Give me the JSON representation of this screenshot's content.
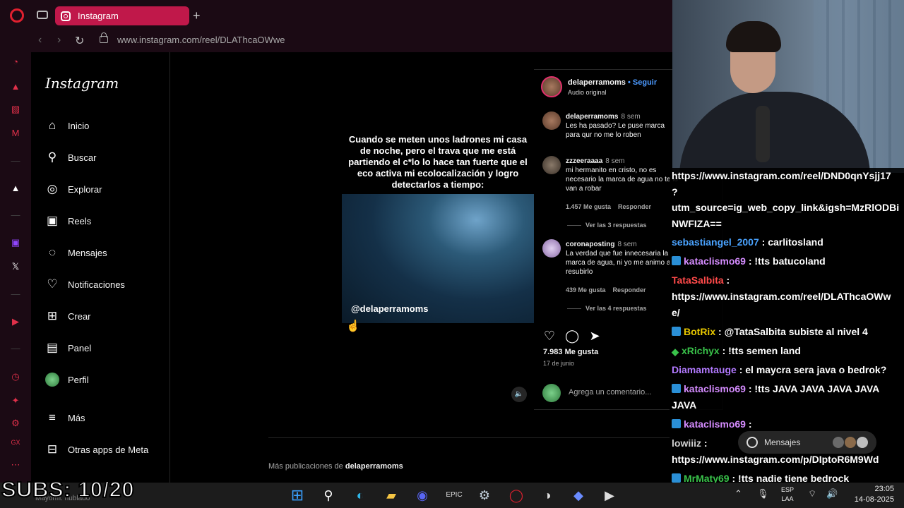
{
  "browser": {
    "tab_title": "Instagram",
    "url": "www.instagram.com/reel/DLAThcaOWwe"
  },
  "instagram": {
    "logo": "Instagram",
    "nav": [
      {
        "label": "Inicio",
        "icon": "home-icon"
      },
      {
        "label": "Buscar",
        "icon": "search-icon"
      },
      {
        "label": "Explorar",
        "icon": "compass-icon"
      },
      {
        "label": "Reels",
        "icon": "reels-icon"
      },
      {
        "label": "Mensajes",
        "icon": "messenger-icon"
      },
      {
        "label": "Notificaciones",
        "icon": "heart-icon"
      },
      {
        "label": "Crear",
        "icon": "plus-square-icon"
      },
      {
        "label": "Panel",
        "icon": "chart-icon"
      },
      {
        "label": "Perfil",
        "icon": "avatar"
      },
      {
        "label": "Más",
        "icon": "menu-icon"
      },
      {
        "label": "Otras apps de Meta",
        "icon": "apps-icon"
      }
    ],
    "post": {
      "caption": "Cuando se meten unos ladrones mi casa de noche, pero el trava que me está partiendo el c*lo lo hace tan fuerte que el eco activa mi ecolocalización y logro detectarlos a tiempo:",
      "watermark": "@delaperramoms",
      "username": "delaperramoms",
      "follow": "• Seguir",
      "audio": "Audio original",
      "likes": "7.983 Me gusta",
      "date": "17 de junio",
      "comment_placeholder": "Agrega un comentario..."
    },
    "comments": [
      {
        "user": "delaperramoms",
        "time": "8 sem",
        "text": "Les ha pasado? Le puse marca para qur no me lo roben"
      },
      {
        "user": "zzzeeraaaa",
        "time": "8 sem",
        "text": "mi hermanito en cristo, no es necesario la marca de agua no te lo van a robar",
        "likes": "1.457 Me gusta",
        "reply": "Responder",
        "replies": "Ver las 3 respuestas"
      },
      {
        "user": "coronaposting",
        "time": "8 sem",
        "text": "La verdad que fue innecesaria la marca de agua, ni yo me animo a resubirlo",
        "likes": "439 Me gusta",
        "reply": "Responder",
        "replies": "Ver las 4 respuestas"
      }
    ],
    "more_posts_prefix": "Más publicaciones de",
    "more_posts_user": "delaperramoms"
  },
  "chat": {
    "lines": [
      {
        "text": "https://www.instagram.com/reel/DND0qnYsjj17"
      },
      {
        "text": "?"
      },
      {
        "text": "utm_source=ig_web_copy_link&igsh=MzRlODBi"
      },
      {
        "text": "NWFIZA=="
      },
      {
        "user": "sebastiangel_2007",
        "color": "#4aa3ff",
        "msg": ": carlitosland"
      },
      {
        "user": "kataclismo69",
        "color": "#d58cff",
        "msg": ": !tts batucoland",
        "badge": "blue"
      },
      {
        "user": "TataSalbita",
        "color": "#ff4a4a",
        "msg": ":"
      },
      {
        "text": "https://www.instagram.com/reel/DLAThcaOWw"
      },
      {
        "text": "e/"
      },
      {
        "user": "BotRix",
        "color": "#e8c800",
        "msg": ": @TataSalbita subiste al nivel 4",
        "badge": "blue"
      },
      {
        "user": "xRichyx",
        "color": "#39c24a",
        "msg": ": !tts semen land",
        "badge": "diamond"
      },
      {
        "user": "Diamamtauge",
        "color": "#b27aff",
        "msg": ": el maycra sera java o bedrok?"
      },
      {
        "user": "kataclismo69",
        "color": "#d58cff",
        "msg": ": !tts JAVA JAVA JAVA JAVA",
        "badge": "blue"
      },
      {
        "text": "JAVA"
      },
      {
        "user": "kataclismo69",
        "color": "#d58cff",
        "msg": ":",
        "badge": "blue"
      },
      {
        "user": "lowiiiz",
        "color": "#d0d0d0",
        "msg": ":"
      },
      {
        "text": "https://www.instagram.com/p/DIptoR6M9Wd"
      },
      {
        "user": "MrMaty69",
        "color": "#39c24a",
        "msg": ": !tts nadie tiene bedrock",
        "badge": "blue"
      }
    ],
    "messages_pill": "Mensajes"
  },
  "overlay": {
    "subs": "SUBS: 10/20",
    "weather": "Mayorm. nublado"
  },
  "taskbar": {
    "lang_top": "ESP",
    "lang_bottom": "LAA",
    "time": "23:05",
    "date": "14-08-2025"
  }
}
